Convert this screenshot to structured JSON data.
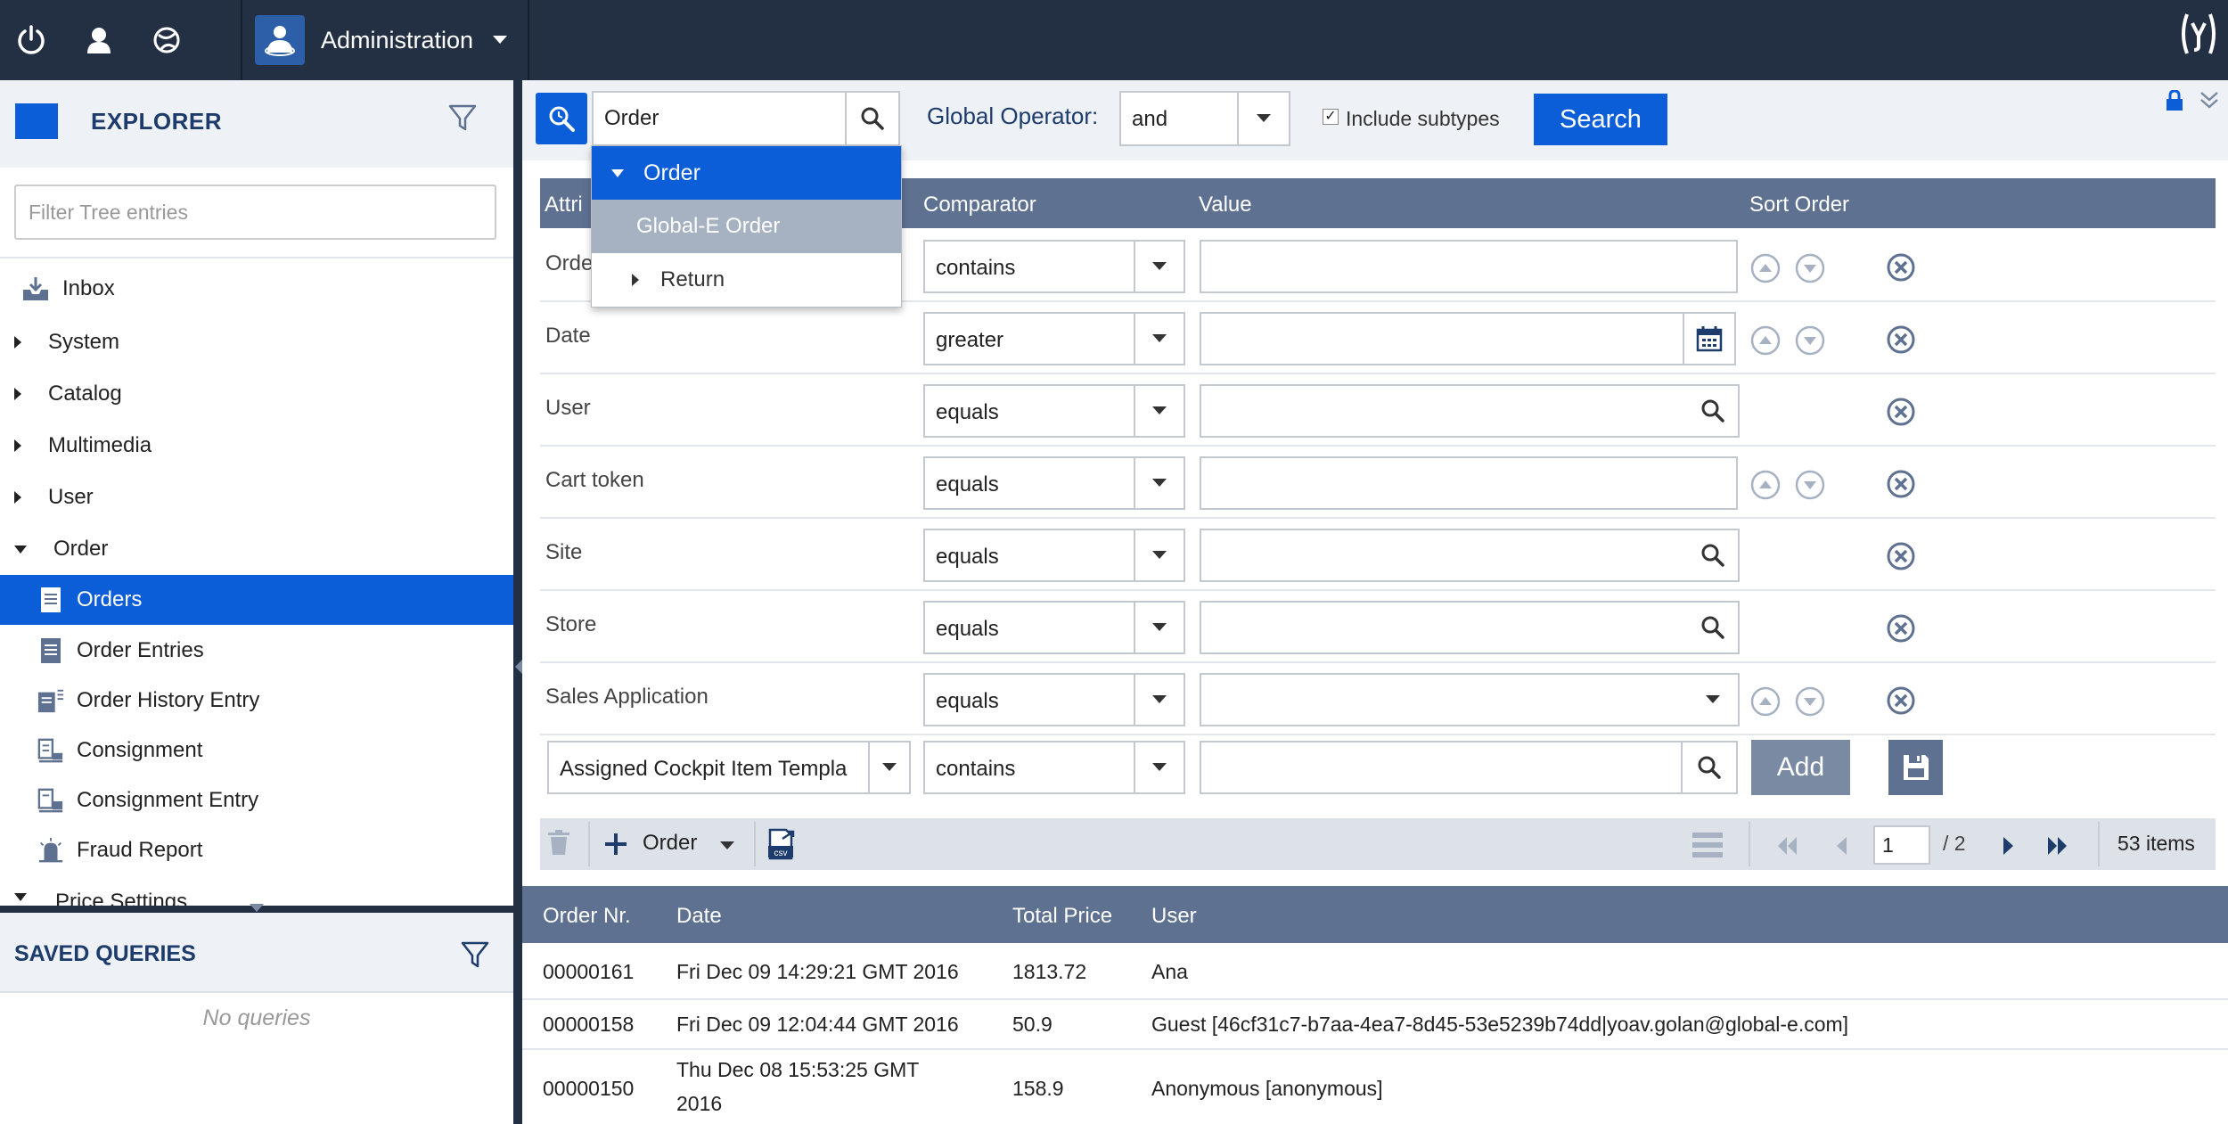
{
  "topbar": {
    "module_label": "Administration",
    "icons": [
      "power-icon",
      "user-icon",
      "globe-icon",
      "admin-avatar-icon",
      "sap-hybris-icon"
    ]
  },
  "explorer": {
    "title": "EXPLORER",
    "filter_placeholder": "Filter Tree entries",
    "tree": [
      {
        "label": "Inbox",
        "icon": "inbox-icon"
      },
      {
        "label": "System",
        "expanded": false
      },
      {
        "label": "Catalog",
        "expanded": false
      },
      {
        "label": "Multimedia",
        "expanded": false
      },
      {
        "label": "User",
        "expanded": false
      },
      {
        "label": "Order",
        "expanded": true
      },
      {
        "label": "Orders",
        "selected": true,
        "icon": "document-icon"
      },
      {
        "label": "Order Entries",
        "icon": "document-icon"
      },
      {
        "label": "Order History Entry",
        "icon": "document-list-icon"
      },
      {
        "label": "Consignment",
        "icon": "consignment-icon"
      },
      {
        "label": "Consignment Entry",
        "icon": "consignment-icon"
      },
      {
        "label": "Fraud Report",
        "icon": "fraud-icon"
      },
      {
        "label": "Price Settings",
        "expanded": false
      }
    ]
  },
  "saved_queries": {
    "title": "SAVED QUERIES",
    "empty_text": "No queries"
  },
  "query": {
    "type_value": "Order",
    "global_operator_label": "Global Operator:",
    "global_operator_value": "and",
    "include_subtypes_label": "Include subtypes",
    "include_subtypes_checked": true,
    "search_label": "Search"
  },
  "type_dropdown": {
    "items": [
      "Order",
      "Global-E Order",
      "Return"
    ]
  },
  "criteria": {
    "headers": {
      "attribute": "Attri",
      "comparator": "Comparator",
      "value": "Value",
      "sort": "Sort Order"
    },
    "rows": [
      {
        "attribute": "Orde",
        "comparator": "contains",
        "value_button": "none",
        "sortable": true
      },
      {
        "attribute": "Date",
        "comparator": "greater",
        "value_button": "calendar-icon",
        "sortable": true
      },
      {
        "attribute": "User",
        "comparator": "equals",
        "value_button": "search-icon",
        "sortable": false
      },
      {
        "attribute": "Cart token",
        "comparator": "equals",
        "value_button": "none",
        "sortable": true
      },
      {
        "attribute": "Site",
        "comparator": "equals",
        "value_button": "search-icon",
        "sortable": false
      },
      {
        "attribute": "Store",
        "comparator": "equals",
        "value_button": "search-icon",
        "sortable": false
      },
      {
        "attribute": "Sales Application",
        "comparator": "equals",
        "value_button": "chevron-down-icon",
        "sortable": true
      }
    ],
    "add_row": {
      "attribute": "Assigned Cockpit Item Templa",
      "comparator": "contains",
      "add_label": "Add"
    }
  },
  "toolbar": {
    "create_label": "Order",
    "page_current": "1",
    "page_total": "/ 2",
    "items_count": "53 items"
  },
  "results": {
    "headers": {
      "order_nr": "Order Nr.",
      "date": "Date",
      "total": "Total Price",
      "user": "User"
    },
    "rows": [
      {
        "order_nr": "00000161",
        "date": "Fri Dec 09 14:29:21 GMT 2016",
        "total": "1813.72",
        "user": "Ana"
      },
      {
        "order_nr": "00000158",
        "date": "Fri Dec 09 12:04:44 GMT 2016",
        "total": "50.9",
        "user": "Guest [46cf31c7-b7aa-4ea7-8d45-53e5239b74dd|yoav.golan@global-e.com]"
      },
      {
        "order_nr": "00000150",
        "date": "Thu Dec 08 15:53:25 GMT 2016",
        "total": "158.9",
        "user": "Anonymous [anonymous]"
      }
    ]
  },
  "colors": {
    "topbar": "#233044",
    "accent": "#0b5ed7",
    "header_slate": "#5f7191",
    "panel_bg": "#eef1f5"
  }
}
